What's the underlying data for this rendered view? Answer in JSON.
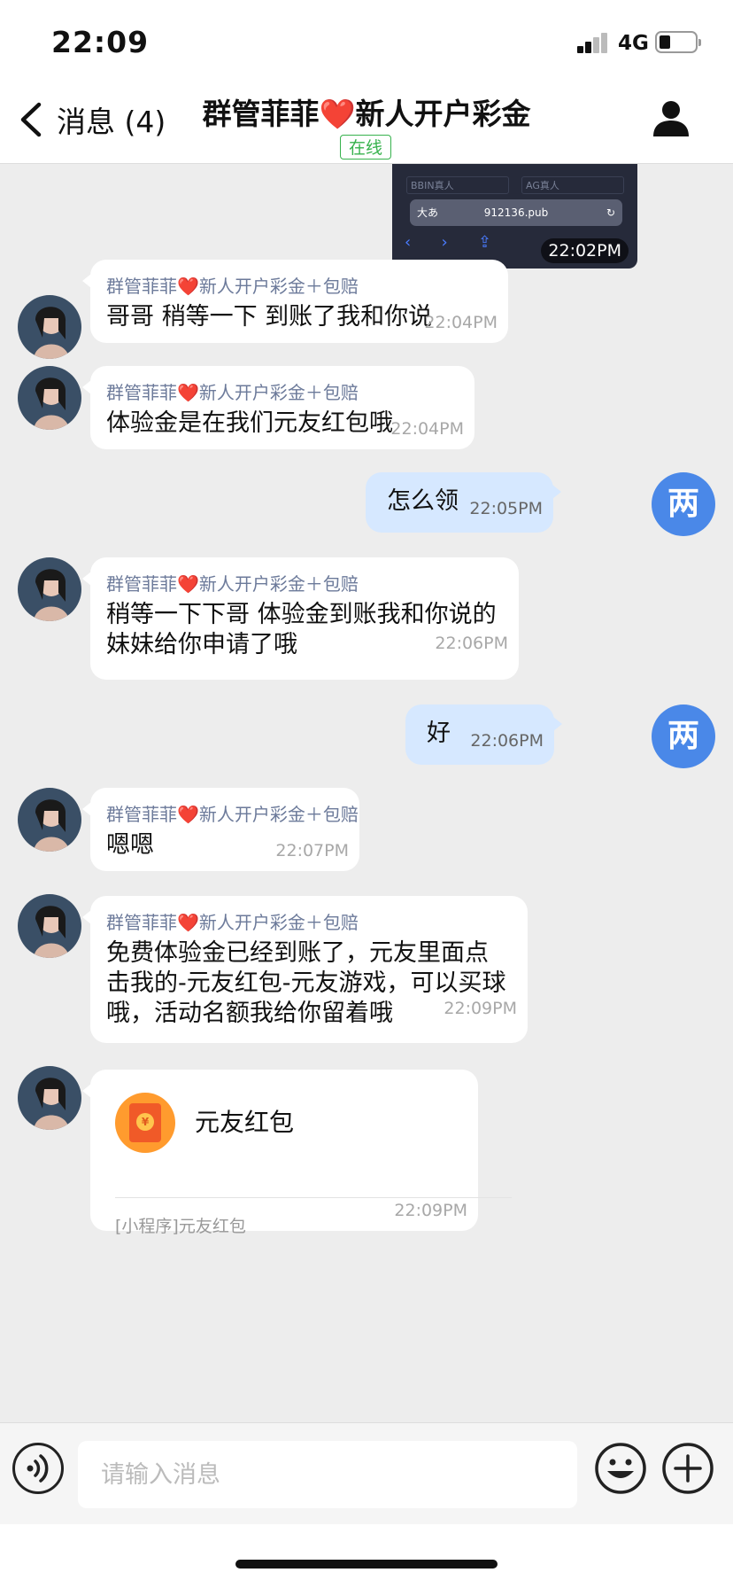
{
  "status_bar": {
    "time": "22:09",
    "network": "4G"
  },
  "header": {
    "back_label": "消息 (4)",
    "title": "群管菲菲❤️新人开户彩金",
    "online_badge": "在线"
  },
  "image_message": {
    "row_a": "BBIN真人",
    "row_b": "AG真人",
    "url_aa": "大あ",
    "url": "912136.pub",
    "timestamp": "22:02PM"
  },
  "sender_name": "群管菲菲❤️新人开户彩金＋包赔",
  "me_avatar_text": "两",
  "messages": [
    {
      "side": "in",
      "text": "哥哥 稍等一下 到账了我和你说",
      "time": "22:04PM"
    },
    {
      "side": "in",
      "text": "体验金是在我们元友红包哦",
      "time": "22:04PM"
    },
    {
      "side": "out",
      "text": "怎么领",
      "time": "22:05PM"
    },
    {
      "side": "in",
      "text": "稍等一下下哥 体验金到账我和你说的 妹妹给你申请了哦",
      "time": "22:06PM"
    },
    {
      "side": "out",
      "text": "好",
      "time": "22:06PM"
    },
    {
      "side": "in",
      "text": "嗯嗯",
      "time": "22:07PM"
    },
    {
      "side": "in",
      "text": "免费体验金已经到账了，元友里面点击我的-元友红包-元友游戏，可以买球哦，活动名额我给你留着哦",
      "time": "22:09PM"
    }
  ],
  "mini_program_card": {
    "title": "元友红包",
    "subtitle": "[小程序]元友红包",
    "time": "22:09PM"
  },
  "input": {
    "placeholder": "请输入消息"
  },
  "icons": [
    "back-chevron-icon",
    "profile-icon",
    "voice-icon",
    "emoji-icon",
    "plus-icon",
    "red-envelope-icon"
  ],
  "colors": {
    "accent_blue": "#4a88e8",
    "out_bubble": "#d6e8ff",
    "online_green": "#37b24d",
    "heart_red": "#e0212e"
  }
}
